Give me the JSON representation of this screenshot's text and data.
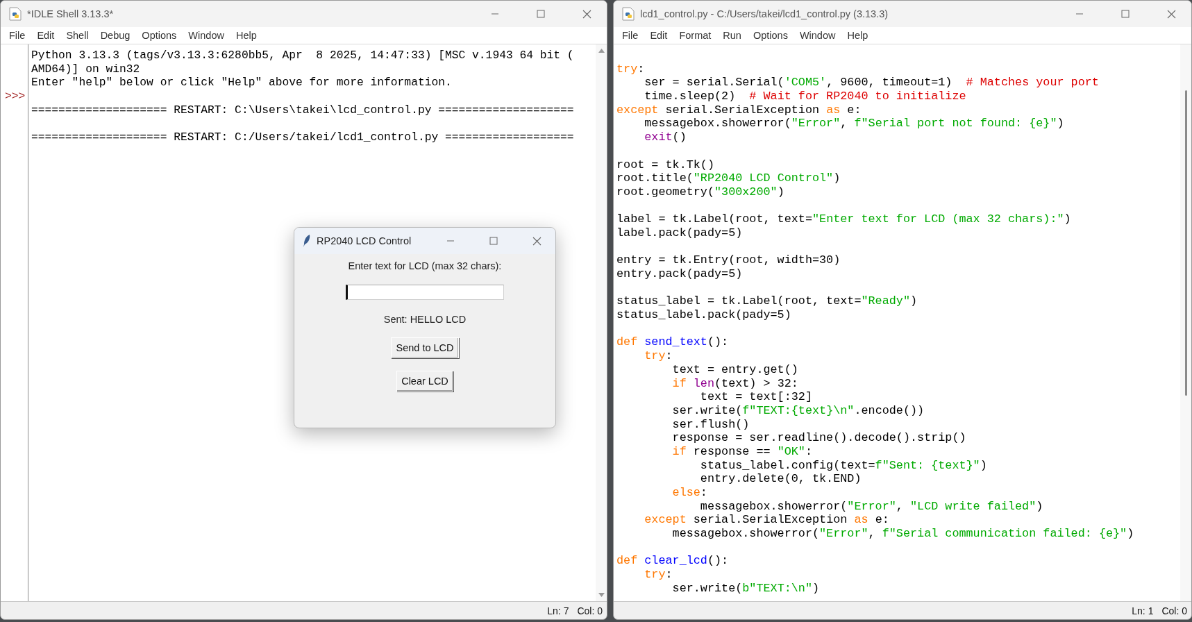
{
  "shell_window": {
    "title": "*IDLE Shell 3.13.3*",
    "menu": [
      "File",
      "Edit",
      "Shell",
      "Debug",
      "Options",
      "Window",
      "Help"
    ],
    "lines": [
      {
        "text": "Python 3.13.3 (tags/v3.13.3:6280bb5, Apr  8 2025, 14:47:33) [MSC v.1943 64 bit ("
      },
      {
        "text": "AMD64)] on win32"
      },
      {
        "text": "Enter \"help\" below or click \"Help\" above for more information."
      },
      {
        "prompt": ">>>"
      },
      {
        "text": "==================== RESTART: C:\\Users\\takei\\lcd_control.py ===================="
      },
      {
        "text": "==================== RESTART: C:/Users/takei/lcd1_control.py ===================",
        "space_before": true
      }
    ],
    "status": {
      "line": "Ln: 7",
      "column": "Col: 0"
    }
  },
  "editor_window": {
    "title": "lcd1_control.py - C:/Users/takei/lcd1_control.py (3.13.3)",
    "menu": [
      "File",
      "Edit",
      "Format",
      "Run",
      "Options",
      "Window",
      "Help"
    ],
    "lines": [
      {
        "space_before": true,
        "tokens": [
          {
            "kind": "keyword",
            "text": "try"
          },
          {
            "kind": "plain",
            "text": ":"
          }
        ]
      },
      {
        "tokens": [
          {
            "kind": "plain",
            "text": "    ser = serial.Serial("
          },
          {
            "kind": "string",
            "text": "'COM5'"
          },
          {
            "kind": "plain",
            "text": ", 9600, timeout=1)  "
          },
          {
            "kind": "comment",
            "text": "# Matches your port"
          }
        ]
      },
      {
        "tokens": [
          {
            "kind": "plain",
            "text": "    time.sleep(2)  "
          },
          {
            "kind": "comment",
            "text": "# Wait for RP2040 to initialize"
          }
        ]
      },
      {
        "tokens": [
          {
            "kind": "keyword",
            "text": "except"
          },
          {
            "kind": "plain",
            "text": " serial.SerialException "
          },
          {
            "kind": "keyword",
            "text": "as"
          },
          {
            "kind": "plain",
            "text": " e:"
          }
        ]
      },
      {
        "tokens": [
          {
            "kind": "plain",
            "text": "    messagebox.showerror("
          },
          {
            "kind": "string",
            "text": "\"Error\""
          },
          {
            "kind": "plain",
            "text": ", "
          },
          {
            "kind": "string",
            "text": "f\"Serial port not found: {e}\""
          },
          {
            "kind": "plain",
            "text": ")"
          }
        ]
      },
      {
        "tokens": [
          {
            "kind": "builtin",
            "text": "    exit"
          },
          {
            "kind": "plain",
            "text": "()"
          }
        ]
      },
      {
        "space_before": true,
        "tokens": [
          {
            "kind": "plain",
            "text": "root = tk.Tk()"
          }
        ]
      },
      {
        "tokens": [
          {
            "kind": "plain",
            "text": "root.title("
          },
          {
            "kind": "string",
            "text": "\"RP2040 LCD Control\""
          },
          {
            "kind": "plain",
            "text": ")"
          }
        ]
      },
      {
        "tokens": [
          {
            "kind": "plain",
            "text": "root.geometry("
          },
          {
            "kind": "string",
            "text": "\"300x200\""
          },
          {
            "kind": "plain",
            "text": ")"
          }
        ]
      },
      {
        "space_before": true,
        "tokens": [
          {
            "kind": "plain",
            "text": "label = tk.Label(root, text="
          },
          {
            "kind": "string",
            "text": "\"Enter text for LCD (max 32 chars):\""
          },
          {
            "kind": "plain",
            "text": ")"
          }
        ]
      },
      {
        "tokens": [
          {
            "kind": "plain",
            "text": "label.pack(pady=5)"
          }
        ]
      },
      {
        "space_before": true,
        "tokens": [
          {
            "kind": "plain",
            "text": "entry = tk.Entry(root, width=30)"
          }
        ]
      },
      {
        "tokens": [
          {
            "kind": "plain",
            "text": "entry.pack(pady=5)"
          }
        ]
      },
      {
        "space_before": true,
        "tokens": [
          {
            "kind": "plain",
            "text": "status_label = tk.Label(root, text="
          },
          {
            "kind": "string",
            "text": "\"Ready\""
          },
          {
            "kind": "plain",
            "text": ")"
          }
        ]
      },
      {
        "tokens": [
          {
            "kind": "plain",
            "text": "status_label.pack(pady=5)"
          }
        ]
      },
      {
        "space_before": true,
        "tokens": [
          {
            "kind": "keyword",
            "text": "def"
          },
          {
            "kind": "definition",
            "text": " send_text"
          },
          {
            "kind": "plain",
            "text": "():"
          }
        ]
      },
      {
        "tokens": [
          {
            "kind": "keyword",
            "text": "    try"
          },
          {
            "kind": "plain",
            "text": ":"
          }
        ]
      },
      {
        "tokens": [
          {
            "kind": "plain",
            "text": "        text = entry.get()"
          }
        ]
      },
      {
        "tokens": [
          {
            "kind": "keyword",
            "text": "        if"
          },
          {
            "kind": "builtin",
            "text": " len"
          },
          {
            "kind": "plain",
            "text": "(text) > 32:"
          }
        ]
      },
      {
        "tokens": [
          {
            "kind": "plain",
            "text": "            text = text[:32]"
          }
        ]
      },
      {
        "tokens": [
          {
            "kind": "plain",
            "text": "        ser.write("
          },
          {
            "kind": "string",
            "text": "f\"TEXT:{text}\\n\""
          },
          {
            "kind": "plain",
            "text": ".encode())"
          }
        ]
      },
      {
        "tokens": [
          {
            "kind": "plain",
            "text": "        ser.flush()"
          }
        ]
      },
      {
        "tokens": [
          {
            "kind": "plain",
            "text": "        response = ser.readline().decode().strip()"
          }
        ]
      },
      {
        "tokens": [
          {
            "kind": "keyword",
            "text": "        if"
          },
          {
            "kind": "plain",
            "text": " response == "
          },
          {
            "kind": "string",
            "text": "\"OK\""
          },
          {
            "kind": "plain",
            "text": ":"
          }
        ]
      },
      {
        "tokens": [
          {
            "kind": "plain",
            "text": "            status_label.config(text="
          },
          {
            "kind": "string",
            "text": "f\"Sent: {text}\""
          },
          {
            "kind": "plain",
            "text": ")"
          }
        ]
      },
      {
        "tokens": [
          {
            "kind": "plain",
            "text": "            entry.delete(0, tk.END)"
          }
        ]
      },
      {
        "tokens": [
          {
            "kind": "keyword",
            "text": "        else"
          },
          {
            "kind": "plain",
            "text": ":"
          }
        ]
      },
      {
        "tokens": [
          {
            "kind": "plain",
            "text": "            messagebox.showerror("
          },
          {
            "kind": "string",
            "text": "\"Error\""
          },
          {
            "kind": "plain",
            "text": ", "
          },
          {
            "kind": "string",
            "text": "\"LCD write failed\""
          },
          {
            "kind": "plain",
            "text": ")"
          }
        ]
      },
      {
        "tokens": [
          {
            "kind": "keyword",
            "text": "    except"
          },
          {
            "kind": "plain",
            "text": " serial.SerialException "
          },
          {
            "kind": "keyword",
            "text": "as"
          },
          {
            "kind": "plain",
            "text": " e:"
          }
        ]
      },
      {
        "tokens": [
          {
            "kind": "plain",
            "text": "        messagebox.showerror("
          },
          {
            "kind": "string",
            "text": "\"Error\""
          },
          {
            "kind": "plain",
            "text": ", "
          },
          {
            "kind": "string",
            "text": "f\"Serial communication failed: {e}\""
          },
          {
            "kind": "plain",
            "text": ")"
          }
        ]
      },
      {
        "space_before": true,
        "tokens": [
          {
            "kind": "keyword",
            "text": "def"
          },
          {
            "kind": "definition",
            "text": " clear_lcd"
          },
          {
            "kind": "plain",
            "text": "():"
          }
        ]
      },
      {
        "tokens": [
          {
            "kind": "keyword",
            "text": "    try"
          },
          {
            "kind": "plain",
            "text": ":"
          }
        ]
      },
      {
        "tokens": [
          {
            "kind": "plain",
            "text": "        ser.write("
          },
          {
            "kind": "string",
            "text": "b\"TEXT:\\n\""
          },
          {
            "kind": "plain",
            "text": ")"
          }
        ]
      }
    ],
    "status": {
      "line": "Ln: 1",
      "column": "Col: 0"
    }
  },
  "dialog": {
    "title": "RP2040 LCD Control",
    "prompt": "Enter text for LCD (max 32 chars):",
    "status_text": "Sent: HELLO LCD",
    "buttons": [
      "Send to LCD",
      "Clear LCD"
    ]
  }
}
